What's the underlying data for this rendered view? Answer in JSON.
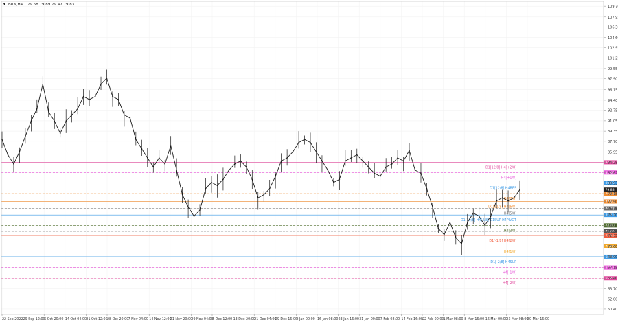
{
  "header": {
    "symbol": "BRN,H4",
    "quote": "79.68 79.89 79.47 79.83"
  },
  "chart_data": {
    "type": "candlestick",
    "symbol": "BRN",
    "timeframe": "H4",
    "ylim": [
      59.5,
      110.5
    ],
    "grid": true,
    "y_ticks": [
      "109.70",
      "107.95",
      "106.30",
      "104.60",
      "102.95",
      "101.25",
      "99.55",
      "97.90",
      "96.15",
      "94.40",
      "92.75",
      "91.05",
      "89.35",
      "87.70",
      "85.95",
      "84.28",
      "82.62",
      "80.93",
      "79.18",
      "77.90",
      "76.78",
      "75.70",
      "74.00",
      "73.04",
      "72.35",
      "70.60",
      "68.90",
      "67.15",
      "65.40",
      "63.70",
      "62.00",
      "60.40"
    ],
    "x_ticks": [
      "22 Sep 2022",
      "29 Sep 12:00",
      "6 Oct 20:00",
      "14 Oct 04:00",
      "21 Oct 12:00",
      "28 Oct 20:00",
      "7 Nov 04:00",
      "14 Nov 12:00",
      "21 Nov 20:00",
      "29 Nov 04:00",
      "6 Dec 12:00",
      "13 Dec 20:00",
      "21 Dec 04:00",
      "29 Dec 16:00",
      "9 Jan 00:00",
      "16 Jan 08:00",
      "23 Jan 16:00",
      "31 Jan 00:00",
      "7 Feb 08:00",
      "14 Feb 16:00",
      "22 Feb 00:00",
      "1 Mar 08:00",
      "8 Mar 16:00",
      "16 Mar 00:00",
      "23 Mar 08:00",
      "30 Mar 16:00"
    ],
    "close_path": [
      {
        "x": "22 Sep 2022",
        "y": 88.0
      },
      {
        "x": "25 Sep 2022",
        "y": 85.5
      },
      {
        "x": "27 Sep 2022",
        "y": 84.0
      },
      {
        "x": "29 Sep 12:00",
        "y": 86.0
      },
      {
        "x": "1 Oct 2022",
        "y": 88.5
      },
      {
        "x": "3 Oct 2022",
        "y": 91.0
      },
      {
        "x": "6 Oct 20:00",
        "y": 93.0
      },
      {
        "x": "9 Oct 2022",
        "y": 97.0
      },
      {
        "x": "11 Oct 2022",
        "y": 92.5
      },
      {
        "x": "14 Oct 04:00",
        "y": 91.0
      },
      {
        "x": "17 Oct 2022",
        "y": 89.0
      },
      {
        "x": "19 Oct 2022",
        "y": 91.0
      },
      {
        "x": "21 Oct 12:00",
        "y": 92.0
      },
      {
        "x": "24 Oct 2022",
        "y": 93.0
      },
      {
        "x": "26 Oct 2022",
        "y": 95.0
      },
      {
        "x": "28 Oct 20:00",
        "y": 94.5
      },
      {
        "x": "1 Nov 2022",
        "y": 95.0
      },
      {
        "x": "4 Nov 2022",
        "y": 97.0
      },
      {
        "x": "7 Nov 04:00",
        "y": 98.0
      },
      {
        "x": "9 Nov 2022",
        "y": 95.0
      },
      {
        "x": "11 Nov 2022",
        "y": 94.5
      },
      {
        "x": "14 Nov 12:00",
        "y": 92.0
      },
      {
        "x": "16 Nov 2022",
        "y": 91.5
      },
      {
        "x": "18 Nov 2022",
        "y": 88.0
      },
      {
        "x": "21 Nov 20:00",
        "y": 86.5
      },
      {
        "x": "23 Nov 2022",
        "y": 85.0
      },
      {
        "x": "25 Nov 2022",
        "y": 83.5
      },
      {
        "x": "27 Nov 2022",
        "y": 85.0
      },
      {
        "x": "29 Nov 04:00",
        "y": 84.0
      },
      {
        "x": "1 Dec 2022",
        "y": 87.0
      },
      {
        "x": "3 Dec 2022",
        "y": 83.0
      },
      {
        "x": "5 Dec 2022",
        "y": 79.0
      },
      {
        "x": "6 Dec 12:00",
        "y": 77.0
      },
      {
        "x": "8 Dec 2022",
        "y": 75.5
      },
      {
        "x": "11 Dec 2022",
        "y": 76.5
      },
      {
        "x": "13 Dec 20:00",
        "y": 80.0
      },
      {
        "x": "15 Dec 2022",
        "y": 81.0
      },
      {
        "x": "18 Dec 2022",
        "y": 80.5
      },
      {
        "x": "21 Dec 04:00",
        "y": 81.5
      },
      {
        "x": "23 Dec 2022",
        "y": 83.0
      },
      {
        "x": "25 Dec 2022",
        "y": 84.0
      },
      {
        "x": "27 Dec 2022",
        "y": 84.5
      },
      {
        "x": "29 Dec 16:00",
        "y": 83.5
      },
      {
        "x": "1 Jan 2023",
        "y": 81.5
      },
      {
        "x": "4 Jan 2023",
        "y": 78.5
      },
      {
        "x": "6 Jan 2023",
        "y": 79.0
      },
      {
        "x": "9 Jan 00:00",
        "y": 80.0
      },
      {
        "x": "12 Jan 2023",
        "y": 82.0
      },
      {
        "x": "14 Jan 2023",
        "y": 84.5
      },
      {
        "x": "16 Jan 08:00",
        "y": 85.0
      },
      {
        "x": "18 Jan 2023",
        "y": 86.0
      },
      {
        "x": "20 Jan 2023",
        "y": 87.5
      },
      {
        "x": "23 Jan 16:00",
        "y": 88.0
      },
      {
        "x": "26 Jan 2023",
        "y": 87.5
      },
      {
        "x": "28 Jan 2023",
        "y": 86.0
      },
      {
        "x": "31 Jan 00:00",
        "y": 84.5
      },
      {
        "x": "2 Feb 2023",
        "y": 83.0
      },
      {
        "x": "4 Feb 2023",
        "y": 81.0
      },
      {
        "x": "7 Feb 08:00",
        "y": 81.5
      },
      {
        "x": "9 Feb 2023",
        "y": 84.5
      },
      {
        "x": "12 Feb 2023",
        "y": 85.0
      },
      {
        "x": "14 Feb 16:00",
        "y": 85.5
      },
      {
        "x": "17 Feb 2023",
        "y": 84.5
      },
      {
        "x": "20 Feb 2023",
        "y": 83.5
      },
      {
        "x": "22 Feb 00:00",
        "y": 82.5
      },
      {
        "x": "24 Feb 2023",
        "y": 82.0
      },
      {
        "x": "27 Feb 2023",
        "y": 83.5
      },
      {
        "x": "1 Mar 08:00",
        "y": 84.0
      },
      {
        "x": "3 Mar 2023",
        "y": 85.0
      },
      {
        "x": "6 Mar 2023",
        "y": 84.5
      },
      {
        "x": "7 Mar 2023",
        "y": 86.2
      },
      {
        "x": "8 Mar 16:00",
        "y": 83.0
      },
      {
        "x": "10 Mar 2023",
        "y": 82.5
      },
      {
        "x": "12 Mar 2023",
        "y": 80.0
      },
      {
        "x": "14 Mar 2023",
        "y": 77.0
      },
      {
        "x": "15 Mar 2023",
        "y": 73.5
      },
      {
        "x": "16 Mar 00:00",
        "y": 72.5
      },
      {
        "x": "17 Mar 2023",
        "y": 74.5
      },
      {
        "x": "19 Mar 2023",
        "y": 72.0
      },
      {
        "x": "20 Mar 2023",
        "y": 71.0
      },
      {
        "x": "21 Mar 2023",
        "y": 74.5
      },
      {
        "x": "22 Mar 2023",
        "y": 76.0
      },
      {
        "x": "23 Mar 08:00",
        "y": 75.5
      },
      {
        "x": "24 Mar 2023",
        "y": 74.0
      },
      {
        "x": "26 Mar 2023",
        "y": 75.5
      },
      {
        "x": "27 Mar 2023",
        "y": 78.0
      },
      {
        "x": "28 Mar 2023",
        "y": 78.5
      },
      {
        "x": "29 Mar 2023",
        "y": 78.0
      },
      {
        "x": "30 Mar 16:00",
        "y": 78.5
      },
      {
        "x": "31 Mar 2023",
        "y": 79.83
      }
    ],
    "levels": [
      {
        "price": 84.28,
        "label": "D1[12/8] H4[+2/8]",
        "tag": "84.28",
        "color": "#e0489c",
        "style": "solid"
      },
      {
        "price": 82.62,
        "label": "H4[+1/8]",
        "tag": "82.62",
        "color": "#e64fd6",
        "style": "dashed"
      },
      {
        "price": 80.93,
        "label": "D1[12/8] H4RES",
        "tag": "80.93",
        "color": "#3b9ae6",
        "style": "solid"
      },
      {
        "price": 79.83,
        "label": "",
        "tag": "79.83",
        "color": "#222222",
        "style": "none"
      },
      {
        "price": 79.18,
        "label": "H4[7/8]",
        "tag": "79.18",
        "color": "#f08a2c",
        "style": "dashed"
      },
      {
        "price": 77.9,
        "label": "D1[11/8] H4[6/8]",
        "tag": "77.90",
        "color": "#f08a2c",
        "style": "solid"
      },
      {
        "price": 76.78,
        "label": "H4[5/8]",
        "tag": "76.78",
        "color": "#6b6b6b",
        "style": "dashed"
      },
      {
        "price": 75.7,
        "label": "D1[10/8] H4[4/8] D1SUP H4PIVOT",
        "tag": "75.70",
        "color": "#3b9ae6",
        "style": "solid"
      },
      {
        "price": 74.0,
        "label": "H4[3/8]",
        "tag": "74.00",
        "color": "#4d6b2a",
        "style": "dashed"
      },
      {
        "price": 73.04,
        "label": "",
        "tag": "73.04",
        "color": "#555555",
        "style": "dashed"
      },
      {
        "price": 72.35,
        "label": "D1[-1/8] H4[2/8]",
        "tag": "72.35",
        "color": "#f05a3a",
        "style": "solid"
      },
      {
        "price": 70.6,
        "label": "H4[1/8]",
        "tag": "70.60",
        "color": "#f0a82c",
        "style": "dashed"
      },
      {
        "price": 68.9,
        "label": "D1[-2/8] H4SUP",
        "tag": "68.90",
        "color": "#3b9ae6",
        "style": "solid"
      },
      {
        "price": 67.15,
        "label": "H4[-1/8]",
        "tag": "67.15",
        "color": "#e64fd6",
        "style": "dashed"
      },
      {
        "price": 65.4,
        "label": "H4[-2/8]",
        "tag": "65.40",
        "color": "#e0489c",
        "style": "dashed"
      }
    ]
  }
}
